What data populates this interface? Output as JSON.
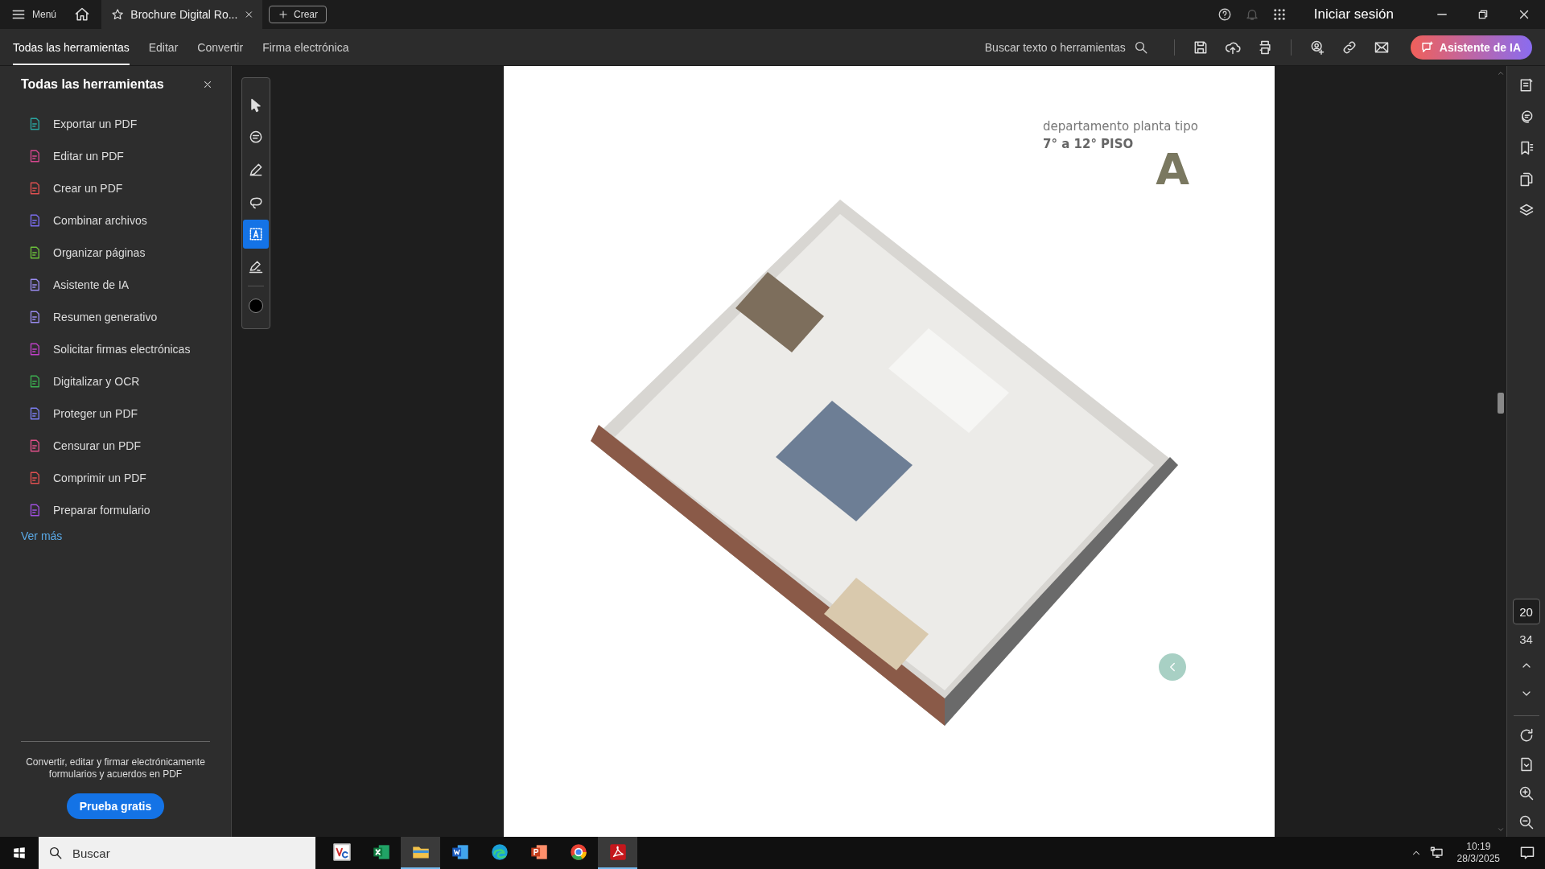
{
  "title_bar": {
    "menu": "Menú",
    "tab": {
      "title": "Brochure Digital Ro...",
      "favorite": false
    },
    "create_button": "Crear",
    "sign_in": "Iniciar sesión"
  },
  "toolbar": {
    "tabs": [
      {
        "label": "Todas las herramientas",
        "selected": true
      },
      {
        "label": "Editar",
        "selected": false
      },
      {
        "label": "Convertir",
        "selected": false
      },
      {
        "label": "Firma electrónica",
        "selected": false
      }
    ],
    "search": "Buscar texto o herramientas",
    "ai_button": "Asistente de IA"
  },
  "tools_panel": {
    "title": "Todas las herramientas",
    "items": [
      {
        "label": "Exportar un PDF",
        "color": "#2aa5a0"
      },
      {
        "label": "Editar un PDF",
        "color": "#d6478f"
      },
      {
        "label": "Crear un PDF",
        "color": "#e05050"
      },
      {
        "label": "Combinar archivos",
        "color": "#7b6ef0"
      },
      {
        "label": "Organizar páginas",
        "color": "#6bbf3b"
      },
      {
        "label": "Asistente de IA",
        "color": "#9a8cf0"
      },
      {
        "label": "Resumen generativo",
        "color": "#9a8cf0"
      },
      {
        "label": "Solicitar firmas electrónicas",
        "color": "#c040c8"
      },
      {
        "label": "Digitalizar y OCR",
        "color": "#3cb050"
      },
      {
        "label": "Proteger un PDF",
        "color": "#7b7ef0"
      },
      {
        "label": "Censurar un PDF",
        "color": "#e0508a"
      },
      {
        "label": "Comprimir un PDF",
        "color": "#e05050"
      },
      {
        "label": "Preparar formulario",
        "color": "#a050e0"
      }
    ],
    "see_more": "Ver más",
    "promo": {
      "text": "Convertir, editar y firmar electrónicamente formularios y acuerdos en PDF",
      "button": "Prueba gratis"
    }
  },
  "quick_tools": [
    {
      "kind": "pointer",
      "selected": false
    },
    {
      "kind": "comment",
      "selected": false
    },
    {
      "kind": "pen",
      "selected": false
    },
    {
      "kind": "lasso",
      "selected": false
    },
    {
      "kind": "text-select",
      "selected": true
    },
    {
      "kind": "sign",
      "selected": false
    },
    {
      "kind": "color",
      "selected": false
    }
  ],
  "document": {
    "subtitle": "departamento planta tipo",
    "floors": "7° a 12° PISO",
    "unit": "A"
  },
  "page_nav": {
    "current": "20",
    "total": "34"
  },
  "taskbar": {
    "search": {
      "placeholder": "Buscar"
    },
    "apps": [
      {
        "kind": "vnc",
        "active": false
      },
      {
        "kind": "excel",
        "active": false
      },
      {
        "kind": "files",
        "active": true
      },
      {
        "kind": "word",
        "active": false
      },
      {
        "kind": "edge",
        "active": false
      },
      {
        "kind": "powerpoint",
        "active": false
      },
      {
        "kind": "chrome",
        "active": false
      },
      {
        "kind": "acrobat",
        "active": true
      }
    ],
    "time": "10:19",
    "date": "28/3/2025"
  }
}
